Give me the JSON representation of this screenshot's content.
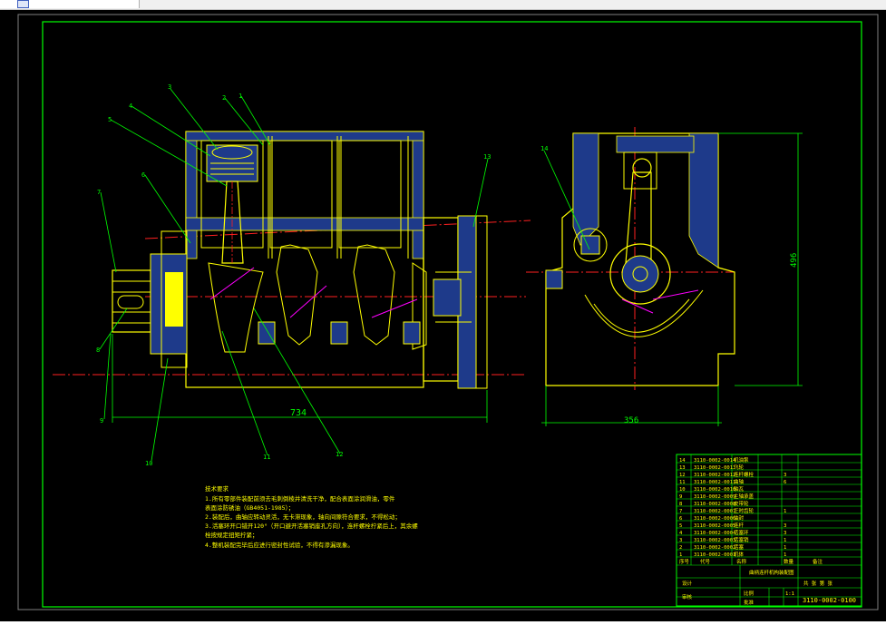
{
  "colors": {
    "background": "#000000",
    "frame": "#00ff00",
    "part_outline": "#ffff00",
    "section_fill": "#1e3a8a",
    "centerline": "#ff2020",
    "detail": "#ff00ff",
    "leader": "#00ff00",
    "dimension": "#00ff00",
    "title_text": "#ffff00"
  },
  "drawing": {
    "dim_width_front": "734",
    "dim_width_side": "356",
    "dim_height_side": "496",
    "callouts": {
      "c1": "1",
      "c2": "2",
      "c3": "3",
      "c4": "4",
      "c5": "5",
      "c6": "6",
      "c7": "7",
      "c8": "8",
      "c9": "9",
      "c10": "10",
      "c11": "11",
      "c12": "12",
      "c13": "13",
      "c14": "14"
    }
  },
  "notes": {
    "heading": "技术要求",
    "line1": "1.所有零部件装配前须去毛刺倒棱并清洗干净，配合表面涂润滑油，零件",
    "line1b": "表面涂防锈油（GB4051-1985）；",
    "line2": "2.装配后，曲轴应转动灵活，无卡滞现象，轴向间隙符合要求，不得松动；",
    "line3": "3.活塞环开口错开120°（开口避开活塞销座孔方向），连杆螺栓拧紧后上，其余螺",
    "line3b": "栓按规定扭矩拧紧；",
    "line4": "4.整机装配完毕后应进行密封性试验，不得有渗漏现象。"
  },
  "title_block": {
    "parts": [
      {
        "no": "14",
        "code": "3110-0002-0014",
        "name": "机油泵",
        "qty": ""
      },
      {
        "no": "13",
        "code": "3110-0002-0013",
        "name": "飞轮",
        "qty": ""
      },
      {
        "no": "12",
        "code": "3110-0002-0012",
        "name": "连杆螺栓",
        "qty": "3"
      },
      {
        "no": "11",
        "code": "3110-0002-0011",
        "name": "曲轴",
        "qty": "6"
      },
      {
        "no": "10",
        "code": "3110-0002-0010",
        "name": "轴瓦",
        "qty": ""
      },
      {
        "no": "9",
        "code": "3110-0002-0009",
        "name": "主轴承盖",
        "qty": ""
      },
      {
        "no": "8",
        "code": "3110-0002-0008",
        "name": "皮带轮",
        "qty": ""
      },
      {
        "no": "7",
        "code": "3110-0002-0007",
        "name": "正时齿轮",
        "qty": "1"
      },
      {
        "no": "6",
        "code": "3110-0002-0006",
        "name": "油封",
        "qty": ""
      },
      {
        "no": "5",
        "code": "3110-0002-0005",
        "name": "连杆",
        "qty": "3"
      },
      {
        "no": "4",
        "code": "3110-0002-0004",
        "name": "活塞环",
        "qty": "3"
      },
      {
        "no": "3",
        "code": "3110-0002-0003",
        "name": "活塞销",
        "qty": "1"
      },
      {
        "no": "2",
        "code": "3110-0002-0002",
        "name": "活塞",
        "qty": "1"
      },
      {
        "no": "1",
        "code": "3110-0002-0001",
        "name": "机体",
        "qty": "1"
      }
    ],
    "header_no": "序号",
    "header_code": "代号",
    "header_name": "名称",
    "header_qty": "数量",
    "header_remark": "备注",
    "assembly_title": "曲柄连杆机构装配图",
    "drawing_number": "3110-0002-0100",
    "scale_label": "比例",
    "scale_value": "1:1",
    "sheet_label": "共 张 第 张",
    "row_labels": {
      "design": "设计",
      "check": "审核",
      "approve": "批准"
    }
  }
}
